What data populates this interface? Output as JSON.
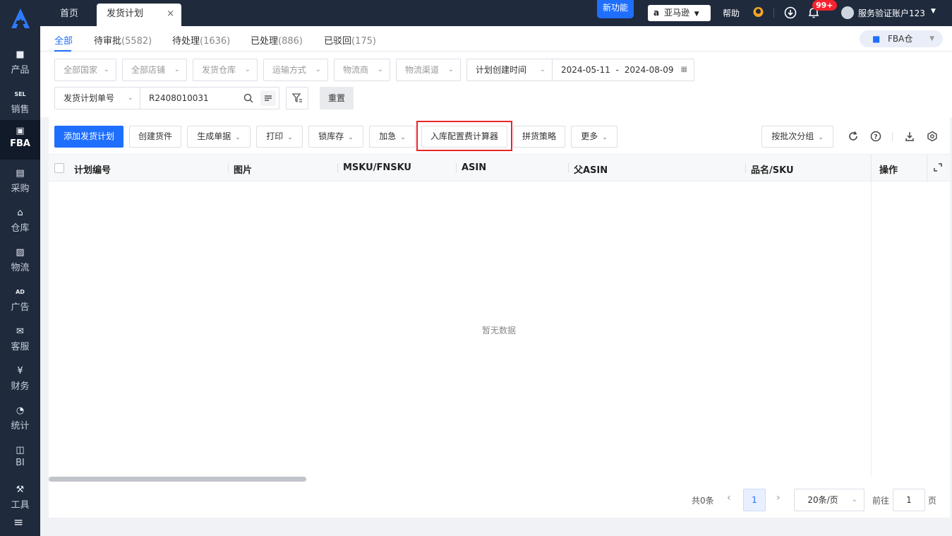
{
  "sidebar": {
    "logo": "logo-icon",
    "items": [
      {
        "label": "产品",
        "icon": "bag-icon"
      },
      {
        "label": "销售",
        "icon": "sel-tag-icon"
      },
      {
        "label": "FBA",
        "icon": "amazon-box-icon"
      },
      {
        "label": "采购",
        "icon": "cart-icon"
      },
      {
        "label": "仓库",
        "icon": "warehouse-icon"
      },
      {
        "label": "物流",
        "icon": "truck-icon"
      },
      {
        "label": "广告",
        "icon": "ad-icon"
      },
      {
        "label": "客服",
        "icon": "mail-icon"
      },
      {
        "label": "财务",
        "icon": "yen-icon"
      },
      {
        "label": "统计",
        "icon": "pie-chart-icon"
      },
      {
        "label": "BI",
        "icon": "bi-board-icon"
      },
      {
        "label": "工具",
        "icon": "wrench-icon"
      }
    ],
    "menu_icon": "menu-collapse-icon",
    "colors": {
      "bg": "#1f2a3d",
      "active_bg": "#111a29"
    }
  },
  "topbar": {
    "tabs": [
      {
        "label": "首页"
      },
      {
        "label": "发货计划",
        "close": "×"
      }
    ],
    "new_feature": "新功能",
    "platform": "亚马逊",
    "help": "帮助",
    "notification_badge": "99+",
    "account": "服务验证账户123"
  },
  "status_tabs": [
    {
      "label": "全部",
      "count": ""
    },
    {
      "label": "待审批",
      "count": "(5582)"
    },
    {
      "label": "待处理",
      "count": "(1636)"
    },
    {
      "label": "已处理",
      "count": "(886)"
    },
    {
      "label": "已驳回",
      "count": "(175)"
    }
  ],
  "fba_selector": "FBA仓",
  "filters": {
    "country": "全部国家",
    "shop": "全部店铺",
    "warehouse": "发货仓库",
    "transport": "运输方式",
    "carrier": "物流商",
    "channel": "物流渠道",
    "date_type": "计划创建时间",
    "date_start": "2024-05-11",
    "date_sep": "-",
    "date_end": "2024-08-09",
    "search_field": "发货计划单号",
    "search_value": "R2408010031",
    "reset": "重置"
  },
  "toolbar": {
    "add_plan": "添加发货计划",
    "create_shipment": "创建货件",
    "generate_docs": "生成单据",
    "print": "打印",
    "lock_stock": "锁库存",
    "urgent": "加急",
    "fee_calculator": "入库配置费计算器",
    "consolidation": "拼货策略",
    "more": "更多",
    "group_by": "按批次分组"
  },
  "table": {
    "columns": [
      "计划编号",
      "图片",
      "MSKU/FNSKU",
      "ASIN",
      "父ASIN",
      "品名/SKU",
      "操作"
    ],
    "empty_text": "暂无数据"
  },
  "pagination": {
    "total": "共0条",
    "current_page": "1",
    "page_size": "20条/页",
    "goto_label": "前往",
    "goto_value": "1",
    "page_suffix": "页"
  },
  "colors": {
    "primary": "#1f6fff",
    "annotation": "#e8262b"
  }
}
